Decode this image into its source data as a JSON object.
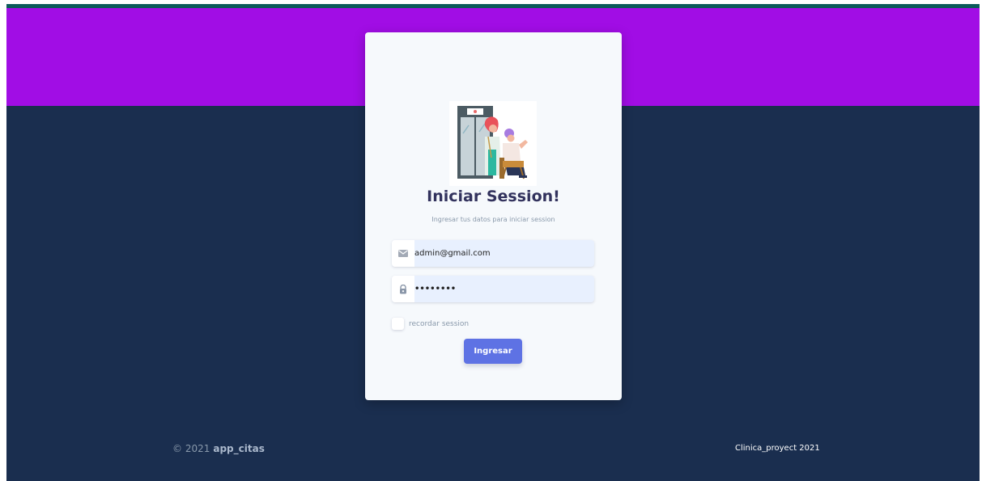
{
  "login": {
    "title": "Iniciar Session!",
    "subtitle": "Ingresar tus datos para iniciar session",
    "email_value": "admin@gmail.com",
    "password_mask": "••••••••",
    "remember_label": "recordar session",
    "submit_label": "Ingresar",
    "illustration_icon": "doctor-patient-illustration"
  },
  "footer": {
    "copyright": "© 2021",
    "brand": "app_citas",
    "right_text": "Clinica_proyect 2021"
  },
  "colors": {
    "banner": "#a10de5",
    "background": "#1a2e4f",
    "card": "#f6f9fc",
    "button": "#5e72e4",
    "field": "#e8f0fe"
  }
}
